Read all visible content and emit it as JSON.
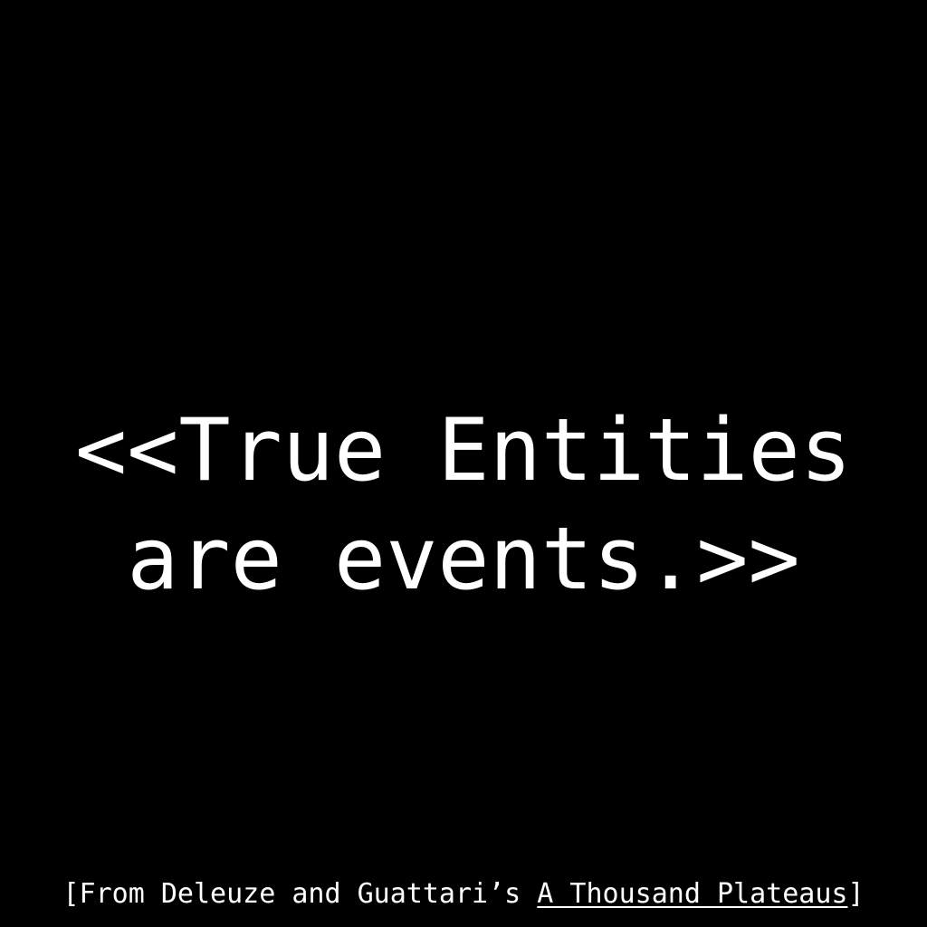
{
  "quote": {
    "line1": "<<True Entities",
    "line2": "are events.>>"
  },
  "caption": {
    "prefix": "[From Deleuze and Guattari’s ",
    "book_title": "A Thousand Plateaus",
    "suffix": "]"
  },
  "colors": {
    "background": "#000000",
    "text": "#ffffff"
  }
}
